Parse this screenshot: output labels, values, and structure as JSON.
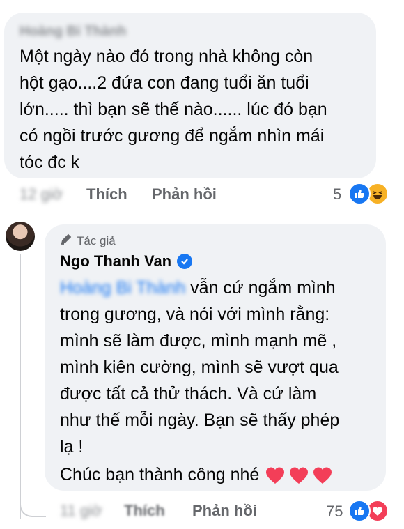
{
  "comment1": {
    "author": "Hoàng Bi Thành",
    "text": "Một ngày nào đó trong nhà không còn\nhột gạo....2 đứa con đang tuổi ăn tuổi\nlớn..... thì bạn sẽ thế nào...... lúc đó bạn\ncó ngồi trước gương để ngắm nhìn mái\ntóc đc k",
    "time": "12 giờ",
    "like_label": "Thích",
    "reply_label": "Phản hồi",
    "reaction_count": "5",
    "reactions": [
      "like-icon",
      "haha-icon"
    ]
  },
  "reply": {
    "badge": "Tác giả",
    "author": "Ngo Thanh Van",
    "verified": true,
    "mention": "Hoàng Bi Thành",
    "text": " vẫn cứ ngắm mình\ntrong gương, và nói với mình rằng:\nmình sẽ làm được, mình mạnh mẽ ,\nmình kiên cường, mình sẽ vượt qua\nđược tất cả thử thách. Và cứ làm\nnhư thế mỗi ngày. Bạn sẽ thấy phép\nlạ !",
    "closing": "Chúc bạn thành công nhé",
    "time": "11 giờ",
    "like_label": "Thích",
    "reply_label": "Phản hồi",
    "reaction_count": "75",
    "reactions": [
      "like-icon",
      "love-icon"
    ]
  },
  "colors": {
    "bubble": "#f0f2f5",
    "secondary_text": "#65676b",
    "link_blue": "#1877f2",
    "heart_red": "#f33e58"
  }
}
